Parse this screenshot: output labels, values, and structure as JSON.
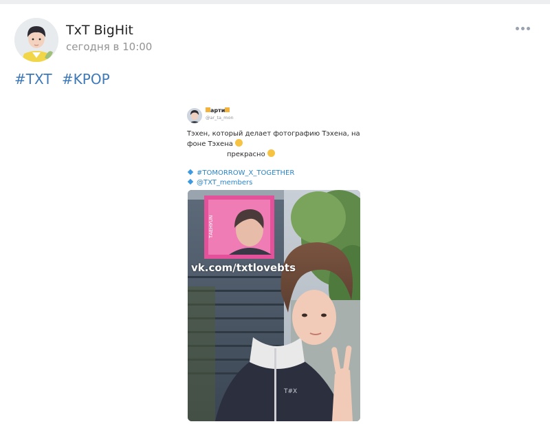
{
  "post": {
    "author": "TxT BigHit",
    "time": "сегодня в 10:00",
    "more_icon": "more-horizontal-icon",
    "hashtags": [
      "#TXT",
      "#KPOP"
    ]
  },
  "tweet": {
    "display_name": "арти",
    "handle": "@ar_ta_mon",
    "text_line1": "Тэхен, который делает фотографию Тэхена, на фоне Тэхена",
    "text_line2": "прекрасно",
    "tags": [
      "#TOMORROW_X_TOGETHER",
      "@TXT_members"
    ],
    "watermark": "vk.com/txtlovebts"
  }
}
